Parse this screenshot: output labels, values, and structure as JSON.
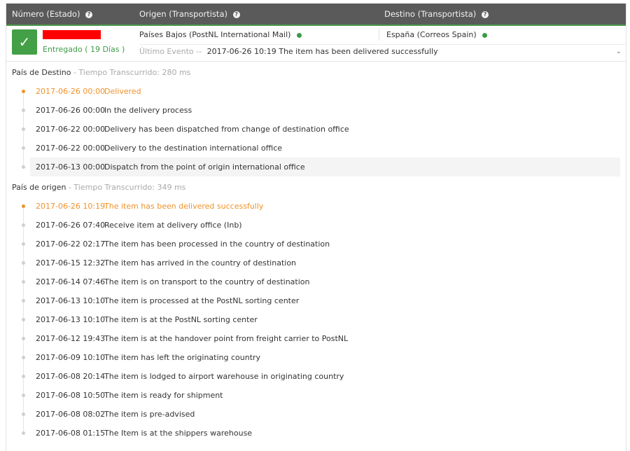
{
  "header": {
    "col1": "Número (Estado)",
    "col2": "Origen (Transportista)",
    "col3": "Destino (Transportista)",
    "help": "?"
  },
  "summary": {
    "check": "✓",
    "status": "Entregado ( 19 Días )",
    "origin": "Países Bajos (PostNL International Mail)",
    "destination": "España (Correos Spain)",
    "last_event_label": "Último Evento --",
    "last_event_value": "2017-06-26 10:19 The item has been delivered successfully",
    "expand": "⌄"
  },
  "sections": [
    {
      "title": "País de Destino",
      "meta": " - Tiempo Transcurrido: 280 ms",
      "events": [
        {
          "date": "2017-06-26 00:00",
          "desc": "Delivered"
        },
        {
          "date": "2017-06-26 00:00",
          "desc": "In the delivery process"
        },
        {
          "date": "2017-06-22 00:00",
          "desc": "Delivery has been dispatched from change of destination office"
        },
        {
          "date": "2017-06-22 00:00",
          "desc": "Delivery to the destination international office"
        },
        {
          "date": "2017-06-13 00:00",
          "desc": "Dispatch from the point of origin international office"
        }
      ]
    },
    {
      "title": "País de origen",
      "meta": " - Tiempo Transcurrido: 349 ms",
      "events": [
        {
          "date": "2017-06-26 10:19",
          "desc": "The item has been delivered successfully"
        },
        {
          "date": "2017-06-26 07:40",
          "desc": "Receive item at delivery office (Inb)"
        },
        {
          "date": "2017-06-22 02:17",
          "desc": "The item has been processed in the country of destination"
        },
        {
          "date": "2017-06-15 12:32",
          "desc": "The item has arrived in the country of destination"
        },
        {
          "date": "2017-06-14 07:46",
          "desc": "The item is on transport to the country of destination"
        },
        {
          "date": "2017-06-13 10:10",
          "desc": "The item is processed at the PostNL sorting center"
        },
        {
          "date": "2017-06-13 10:10",
          "desc": "The item is at the PostNL sorting center"
        },
        {
          "date": "2017-06-12 19:43",
          "desc": "The item is at the handover point from freight carrier to PostNL"
        },
        {
          "date": "2017-06-09 10:10",
          "desc": "The item has left the originating country"
        },
        {
          "date": "2017-06-08 20:14",
          "desc": "The item is lodged to airport warehouse in originating country"
        },
        {
          "date": "2017-06-08 10:50",
          "desc": "The item is ready for shipment"
        },
        {
          "date": "2017-06-08 08:02",
          "desc": "The item is pre-advised"
        },
        {
          "date": "2017-06-08 01:15",
          "desc": "The Item is at the shippers warehouse"
        }
      ]
    }
  ],
  "colors": {
    "header_bg": "#5a5a5a",
    "success": "#43a047",
    "latest_event": "#f0922b",
    "redacted": "#ff0000"
  }
}
